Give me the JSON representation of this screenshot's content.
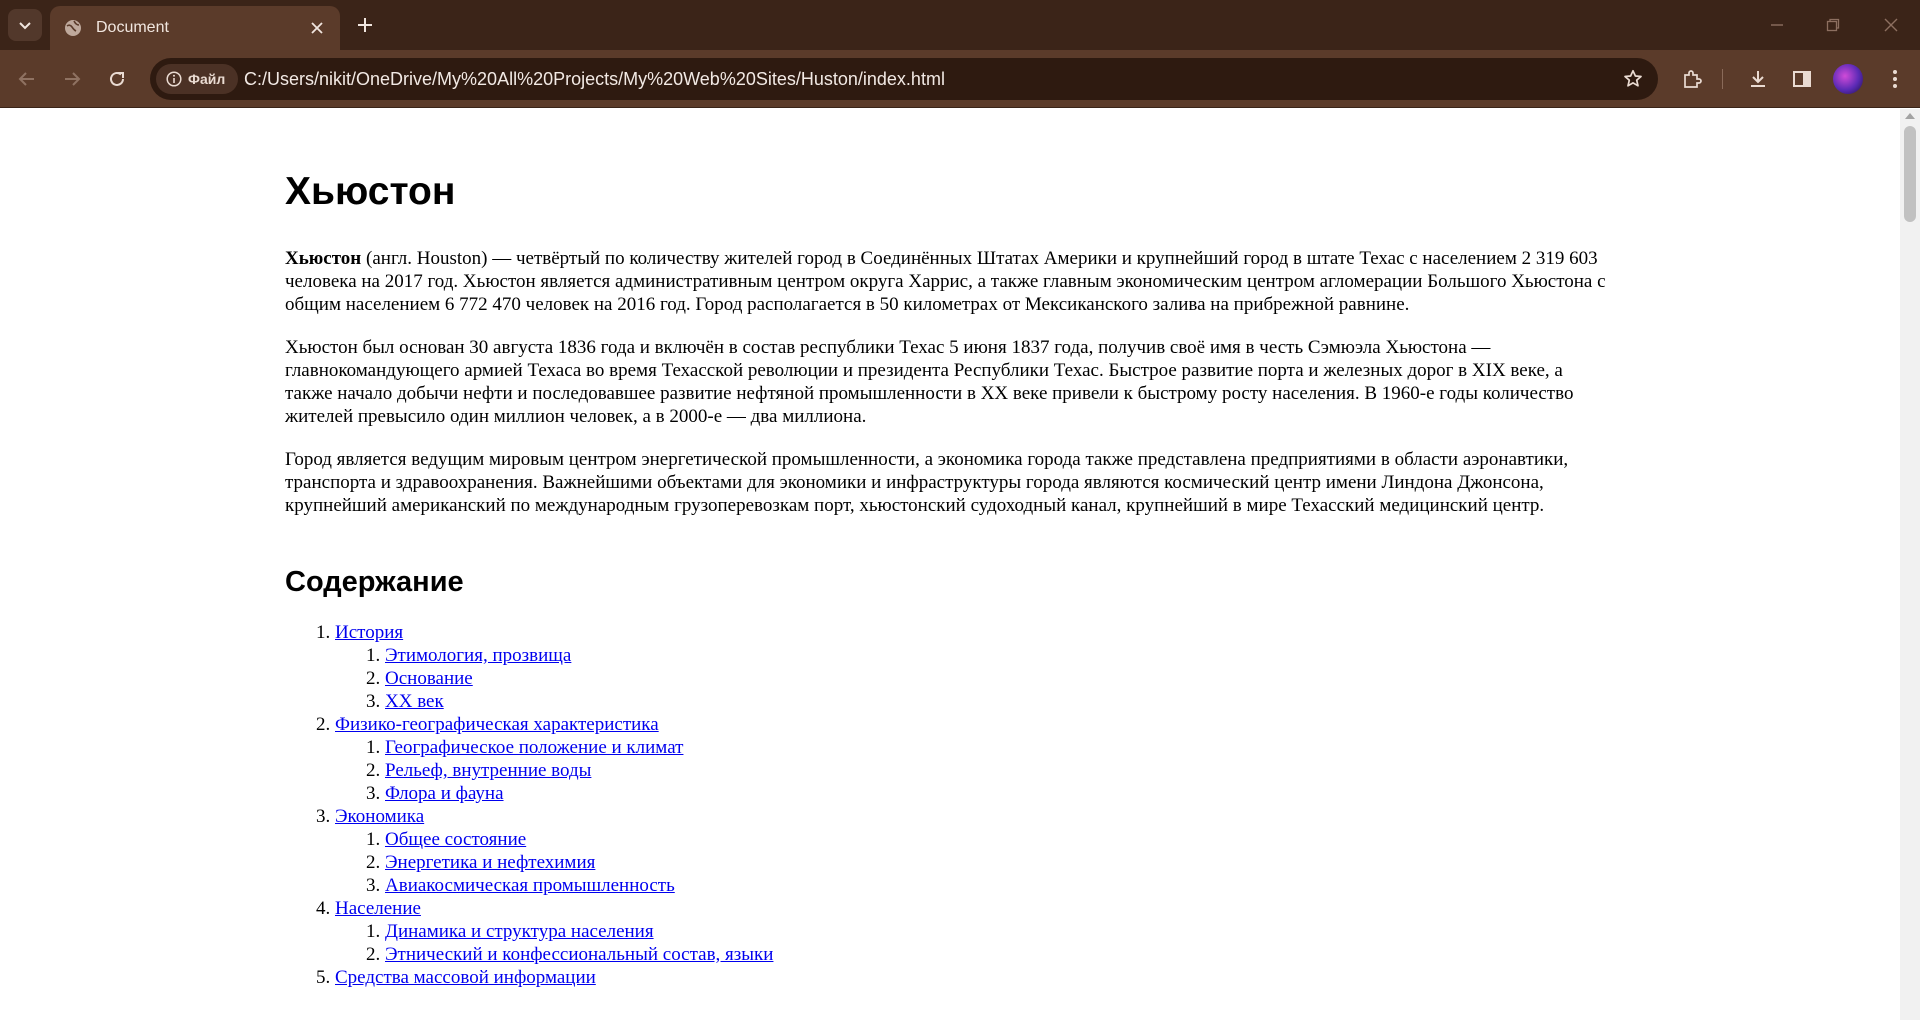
{
  "browser": {
    "tab_title": "Document",
    "security_label": "Файл",
    "url": "C:/Users/nikit/OneDrive/My%20All%20Projects/My%20Web%20Sites/Huston/index.html",
    "colors": {
      "frame": "#3b2418",
      "toolbar": "#5b3b2a",
      "omnibox": "#2e1a10"
    },
    "icons": [
      "tab-search-icon",
      "globe-icon",
      "close-icon",
      "plus-icon",
      "minimize-icon",
      "restore-icon",
      "window-close-icon",
      "back-icon",
      "forward-icon",
      "reload-icon",
      "info-icon",
      "star-icon",
      "extensions-icon",
      "download-icon",
      "side-panel-icon",
      "profile-avatar",
      "menu-icon"
    ]
  },
  "page": {
    "title": "Хьюстон",
    "paragraphs": [
      {
        "bold": "Хьюстон",
        "text": " (англ. Houston) — четвёртый по количеству жителей город в Соединённых Штатах Америки и крупнейший город в штате Техас с населением 2 319 603 человека на 2017 год. Хьюстон является административным центром округа Харрис, а также главным экономическим центром агломерации Большого Хьюстона с общим населением 6 772 470 человек на 2016 год. Город располагается в 50 километрах от Мексиканского залива на прибрежной равнине."
      },
      {
        "text": "Хьюстон был основан 30 августа 1836 года и включён в состав республики Техас 5 июня 1837 года, получив своё имя в честь Сэмюэла Хьюстона — главнокомандующего армией Техаса во время Техасской революции и президента Республики Техас. Быстрое развитие порта и железных дорог в XIX веке, а также начало добычи нефти и последовавшее развитие нефтяной промышленности в XX веке привели к быстрому росту населения. В 1960-е годы количество жителей превысило один миллион человек, а в 2000-е — два миллиона."
      },
      {
        "text": "Город является ведущим мировым центром энергетической промышленности, а экономика города также представлена предприятиями в области аэронавтики, транспорта и здравоохранения. Важнейшими объектами для экономики и инфраструктуры города являются космический центр имени Линдона Джонсона, крупнейший американский по международным грузоперевозкам порт, хьюстонский судоходный канал, крупнейший в мире Техасский медицинский центр."
      }
    ],
    "toc_heading": "Содержание",
    "toc": [
      {
        "label": "История",
        "children": [
          "Этимология, прозвища",
          "Основание",
          "XX век"
        ]
      },
      {
        "label": "Физико-географическая характеристика",
        "children": [
          "Географическое положение и климат",
          "Рельеф, внутренние воды",
          "Флора и фауна"
        ]
      },
      {
        "label": "Экономика",
        "children": [
          "Общее состояние",
          "Энергетика и нефтехимия",
          "Авиакосмическая промышленность"
        ]
      },
      {
        "label": "Население",
        "children": [
          "Динамика и структура населения",
          "Этнический и конфессиональный состав, языки"
        ]
      },
      {
        "label": "Средства массовой информации",
        "children": []
      }
    ]
  }
}
